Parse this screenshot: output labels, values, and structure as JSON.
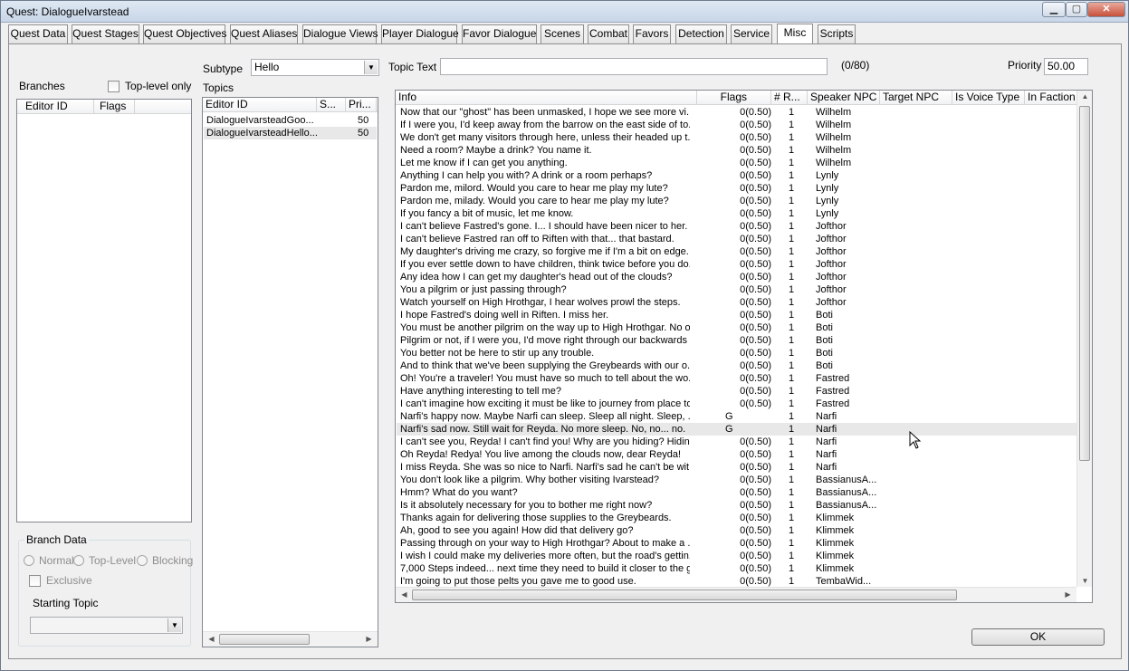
{
  "window": {
    "title": "Quest: DialogueIvarstead"
  },
  "tabs": [
    {
      "label": "Quest Data"
    },
    {
      "label": "Quest Stages"
    },
    {
      "label": "Quest Objectives"
    },
    {
      "label": "Quest Aliases"
    },
    {
      "label": "Dialogue Views"
    },
    {
      "label": "Player Dialogue"
    },
    {
      "label": "Favor Dialogue"
    },
    {
      "label": "Scenes"
    },
    {
      "label": "Combat"
    },
    {
      "label": "Favors"
    },
    {
      "label": "Detection"
    },
    {
      "label": "Service"
    },
    {
      "label": "Misc"
    },
    {
      "label": "Scripts"
    }
  ],
  "branches": {
    "label": "Branches",
    "top_level_only": "Top-level only",
    "columns": [
      "Editor ID",
      "Flags"
    ]
  },
  "subtype": {
    "label": "Subtype",
    "value": "Hello"
  },
  "topics": {
    "label": "Topics",
    "columns": [
      "Editor ID",
      "S...",
      "Pri..."
    ],
    "rows": [
      {
        "id": "DialogueIvarsteadGoo...",
        "pri": "50"
      },
      {
        "id": "DialogueIvarsteadHello...",
        "pri": "50"
      }
    ]
  },
  "topic_text": {
    "label": "Topic Text",
    "value": "",
    "counter": "(0/80)"
  },
  "priority": {
    "label": "Priority",
    "value": "50.00"
  },
  "branch_data": {
    "title": "Branch Data",
    "normal": "Normal",
    "top_level": "Top-Level",
    "blocking": "Blocking",
    "exclusive": "Exclusive",
    "starting_topic": "Starting Topic"
  },
  "info": {
    "columns": [
      "Info",
      "Flags",
      "# R...",
      "Speaker NPC",
      "Target NPC",
      "Is Voice Type",
      "In Faction"
    ],
    "rows": [
      {
        "info": "Now that our \"ghost\" has been unmasked, I hope we see more vi...",
        "flags": "0(0.50)",
        "r": "1",
        "npc": "Wilhelm"
      },
      {
        "info": "If I were you, I'd keep away from the barrow on the east side of to...",
        "flags": "0(0.50)",
        "r": "1",
        "npc": "Wilhelm"
      },
      {
        "info": "We don't get many visitors through here, unless their headed up t...",
        "flags": "0(0.50)",
        "r": "1",
        "npc": "Wilhelm"
      },
      {
        "info": "Need a room? Maybe a drink? You name it.",
        "flags": "0(0.50)",
        "r": "1",
        "npc": "Wilhelm"
      },
      {
        "info": "Let me know if I can get you anything.",
        "flags": "0(0.50)",
        "r": "1",
        "npc": "Wilhelm"
      },
      {
        "info": "Anything I can help you with? A drink or a room perhaps?",
        "flags": "0(0.50)",
        "r": "1",
        "npc": "Lynly"
      },
      {
        "info": "Pardon me, milord. Would you care to hear me play my lute?",
        "flags": "0(0.50)",
        "r": "1",
        "npc": "Lynly"
      },
      {
        "info": "Pardon me, milady. Would you care to hear me play my lute?",
        "flags": "0(0.50)",
        "r": "1",
        "npc": "Lynly"
      },
      {
        "info": "If you fancy a bit of music, let me know.",
        "flags": "0(0.50)",
        "r": "1",
        "npc": "Lynly"
      },
      {
        "info": "I can't believe Fastred's gone. I... I should have been nicer to her.",
        "flags": "0(0.50)",
        "r": "1",
        "npc": "Jofthor"
      },
      {
        "info": "I can't believe Fastred ran off to Riften with that... that bastard.",
        "flags": "0(0.50)",
        "r": "1",
        "npc": "Jofthor"
      },
      {
        "info": "My daughter's driving me crazy, so forgive me if I'm a bit on edge.",
        "flags": "0(0.50)",
        "r": "1",
        "npc": "Jofthor"
      },
      {
        "info": "If you ever settle down to have children, think twice before you do...",
        "flags": "0(0.50)",
        "r": "1",
        "npc": "Jofthor"
      },
      {
        "info": "Any idea how I can get my daughter's head out of the clouds?",
        "flags": "0(0.50)",
        "r": "1",
        "npc": "Jofthor"
      },
      {
        "info": "You a pilgrim or just passing through?",
        "flags": "0(0.50)",
        "r": "1",
        "npc": "Jofthor"
      },
      {
        "info": "Watch yourself on High Hrothgar, I hear wolves prowl the steps.",
        "flags": "0(0.50)",
        "r": "1",
        "npc": "Jofthor"
      },
      {
        "info": "I hope Fastred's doing well in Riften. I miss her.",
        "flags": "0(0.50)",
        "r": "1",
        "npc": "Boti"
      },
      {
        "info": "You must be another pilgrim on the way up to High Hrothgar. No o...",
        "flags": "0(0.50)",
        "r": "1",
        "npc": "Boti"
      },
      {
        "info": "Pilgrim or not, if I were you, I'd move right through our backwards li...",
        "flags": "0(0.50)",
        "r": "1",
        "npc": "Boti"
      },
      {
        "info": "You better not be here to stir up any trouble.",
        "flags": "0(0.50)",
        "r": "1",
        "npc": "Boti"
      },
      {
        "info": "And to think that we've been supplying the Greybeards with our o...",
        "flags": "0(0.50)",
        "r": "1",
        "npc": "Boti"
      },
      {
        "info": "Oh! You're a traveler! You must have so much to tell about the wo...",
        "flags": "0(0.50)",
        "r": "1",
        "npc": "Fastred"
      },
      {
        "info": "Have anything interesting to tell me?",
        "flags": "0(0.50)",
        "r": "1",
        "npc": "Fastred"
      },
      {
        "info": "I can't imagine how exciting it must be like to journey from place to...",
        "flags": "0(0.50)",
        "r": "1",
        "npc": "Fastred"
      },
      {
        "info": "Narfi's happy now. Maybe Narfi can sleep. Sleep all night. Sleep, ...",
        "flags": "G",
        "r": "1",
        "npc": "Narfi"
      },
      {
        "info": "Narfi's sad now. Still wait for Reyda. No more sleep. No, no... no.",
        "flags": "G",
        "r": "1",
        "npc": "Narfi",
        "hl": true
      },
      {
        "info": "I can't see you, Reyda! I can't find you! Why are you hiding? Hidin...",
        "flags": "0(0.50)",
        "r": "1",
        "npc": "Narfi"
      },
      {
        "info": "Oh Reyda! Redya! You live among the clouds now, dear Reyda!",
        "flags": "0(0.50)",
        "r": "1",
        "npc": "Narfi"
      },
      {
        "info": "I miss Reyda. She was so nice to Narfi. Narfi's sad he can't be wit...",
        "flags": "0(0.50)",
        "r": "1",
        "npc": "Narfi"
      },
      {
        "info": "You don't look like a pilgrim. Why bother visiting Ivarstead?",
        "flags": "0(0.50)",
        "r": "1",
        "npc": "BassianusA..."
      },
      {
        "info": "Hmm? What do you want?",
        "flags": "0(0.50)",
        "r": "1",
        "npc": "BassianusA..."
      },
      {
        "info": "Is it absolutely necessary for you to bother me right now?",
        "flags": "0(0.50)",
        "r": "1",
        "npc": "BassianusA..."
      },
      {
        "info": "Thanks again for delivering those supplies to the Greybeards.",
        "flags": "0(0.50)",
        "r": "1",
        "npc": "Klimmek"
      },
      {
        "info": "Ah, good to see you again! How did that delivery go?",
        "flags": "0(0.50)",
        "r": "1",
        "npc": "Klimmek"
      },
      {
        "info": "Passing through on your way to High Hrothgar? About to make a ...",
        "flags": "0(0.50)",
        "r": "1",
        "npc": "Klimmek"
      },
      {
        "info": "I wish I could make my deliveries more often, but the road's gettin...",
        "flags": "0(0.50)",
        "r": "1",
        "npc": "Klimmek"
      },
      {
        "info": "7,000 Steps indeed... next time they need to build it closer to the g...",
        "flags": "0(0.50)",
        "r": "1",
        "npc": "Klimmek"
      },
      {
        "info": "I'm going to put those pelts you gave me to good use.",
        "flags": "0(0.50)",
        "r": "1",
        "npc": "TembaWid..."
      }
    ]
  },
  "ok_button": "OK",
  "icons": {
    "minimize": "minimize-icon",
    "maximize": "maximize-icon",
    "close": "close-icon",
    "cursor": "mouse-cursor-icon"
  }
}
